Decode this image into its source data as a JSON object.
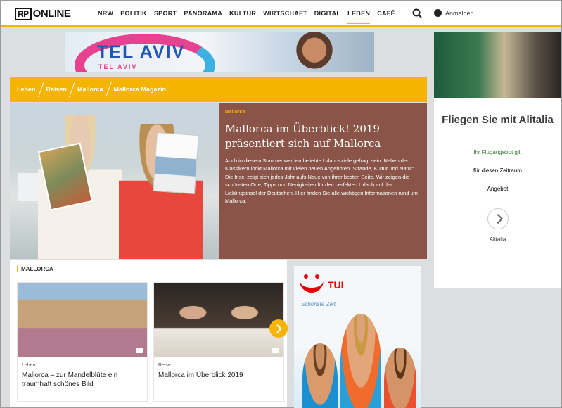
{
  "nav": {
    "logo_rp": "RP",
    "logo_text": "ONLINE",
    "items": [
      "NRW",
      "POLITIK",
      "SPORT",
      "PANORAMA",
      "KULTUR",
      "WIRTSCHAFT",
      "DIGITAL",
      "LEBEN",
      "CAFÉ"
    ],
    "active": "LEBEN",
    "account_label": "Anmelden"
  },
  "ad_top": {
    "headline": "TEL AVIV",
    "subline": "TEL AVIV"
  },
  "ad_right": {
    "headline": "Fliegen Sie mit Alitalia",
    "info_lines": [
      "Ihr Flugangebot gilt",
      "für diesen Zeitraum",
      "Angebot"
    ],
    "cta": "Alitalia"
  },
  "breadcrumb": [
    "Leben",
    "Reisen",
    "Mallorca",
    "Mallorca Magazin"
  ],
  "hero": {
    "kicker": "Mallorca",
    "title": "Mallorca im Überblick! 2019 präsentiert sich auf Mallorca",
    "body": "Auch in diesem Sommer werden beliebte Urlaubsziele gefragt sein. Neben den Klassikern lockt Mallorca mit vielen neuen Angeboten. Strände, Kultur und Natur: Die Insel zeigt sich jedes Jahr aufs Neue von ihrer besten Seite. Wir zeigen die schönsten Orte, Tipps und Neuigkeiten für den perfekten Urlaub auf der Lieblingsinsel der Deutschen. Hier finden Sie alle wichtigen Informationen rund um Mallorca."
  },
  "teasers": {
    "tag": "MALLORCA",
    "cards": [
      {
        "kicker": "Leben",
        "title": "Mallorca – zur Mandelblüte ein traumhaft schönes Bild"
      },
      {
        "kicker": "Reise",
        "title": "Mallorca im Überblick 2019"
      }
    ]
  },
  "ad_tui": {
    "brand": "TUI",
    "tagline": "Schönste Zeit"
  }
}
